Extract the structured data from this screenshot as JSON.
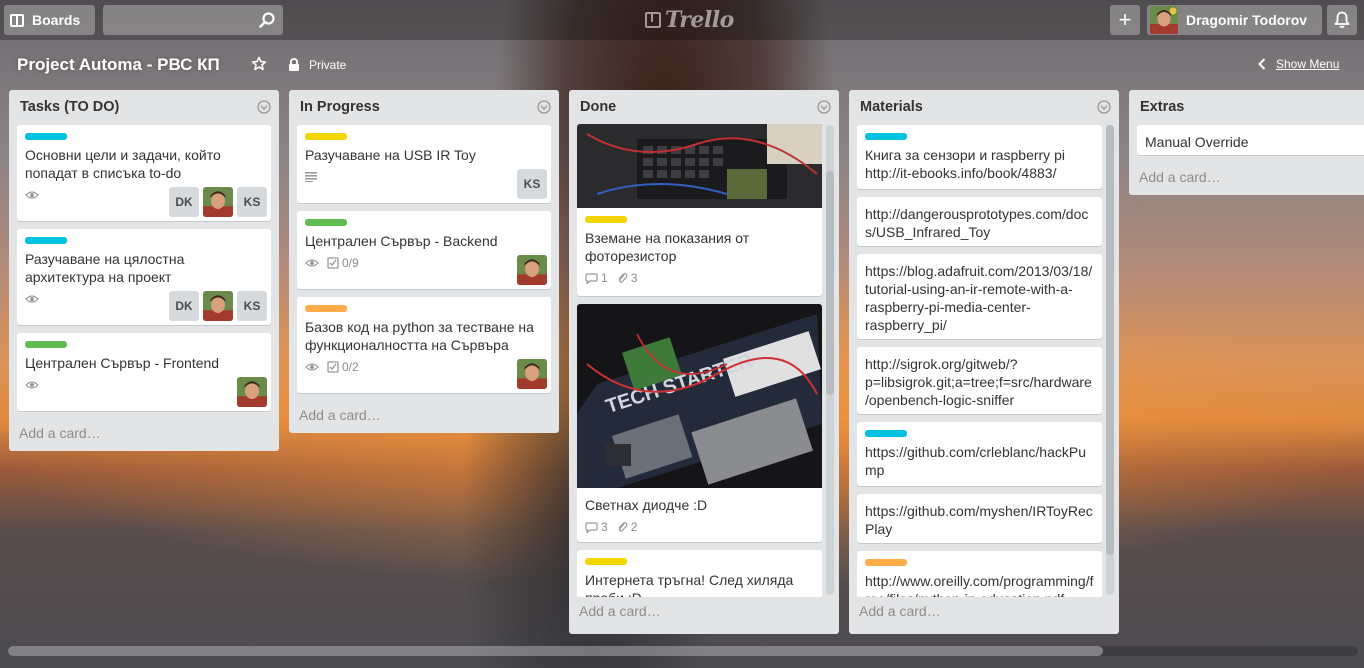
{
  "header": {
    "boards_label": "Boards",
    "search_placeholder": "",
    "logo_text": "Trello",
    "add_label": "+",
    "user_name": "Dragomir Todorov"
  },
  "board": {
    "title": "Project Automa - РВС КП",
    "visibility": "Private",
    "show_menu": "Show Menu"
  },
  "colors": {
    "blue": "#00c2e0",
    "yellow": "#f2d600",
    "green": "#61bd4f",
    "orange": "#ffab4a"
  },
  "lists": [
    {
      "title": "Tasks (TO DO)",
      "add_card": "Add a card…",
      "cards": [
        {
          "label": "blue",
          "title": "Основни цели и задачи, който попадат в списъка to-do",
          "members": [
            "DK",
            "avatar",
            "KS"
          ]
        },
        {
          "label": "blue",
          "title": "Разучаване на цялостна архитектура на проект",
          "members": [
            "DK",
            "avatar",
            "KS"
          ]
        },
        {
          "label": "green",
          "title": "Централен Сървър - Frontend",
          "members": [
            "avatar"
          ]
        }
      ]
    },
    {
      "title": "In Progress",
      "add_card": "Add a card…",
      "cards": [
        {
          "label": "yellow",
          "title": "Разучаване на USB IR Toy",
          "members": [
            "KS"
          ]
        },
        {
          "label": "green",
          "title": "Централен Сървър - Backend",
          "checklist": "0/9",
          "members": [
            "avatar"
          ]
        },
        {
          "label": "orange",
          "title": "Базов код на python за тестване на функционалността на Сървъра",
          "checklist": "0/2",
          "members": [
            "avatar"
          ]
        }
      ]
    },
    {
      "title": "Done",
      "add_card": "Add a card…",
      "cards": [
        {
          "label": "yellow",
          "title": "Вземане на показания от фоторезистор",
          "comments": "1",
          "attachments": "3"
        },
        {
          "title": "Светнах диодче :D",
          "comments": "3",
          "attachments": "2"
        },
        {
          "label": "yellow",
          "title": "Интернета тръгна! След хиляда проби :D"
        }
      ]
    },
    {
      "title": "Materials",
      "add_card": "Add a card…",
      "cards": [
        {
          "label": "blue",
          "title": "Книга за сензори и raspberry pi http://it-ebooks.info/book/4883/"
        },
        {
          "title": "http://dangerousprototypes.com/docs/USB_Infrared_Toy"
        },
        {
          "title": "https://blog.adafruit.com/2013/03/18/tutorial-using-an-ir-remote-with-a-raspberry-pi-media-center-raspberry_pi/"
        },
        {
          "title": "http://sigrok.org/gitweb/?p=libsigrok.git;a=tree;f=src/hardware/openbench-logic-sniffer"
        },
        {
          "label": "blue",
          "title": "https://github.com/crleblanc/hackPump"
        },
        {
          "title": "https://github.com/myshen/IRToyRecPlay"
        },
        {
          "label": "orange",
          "title": "http://www.oreilly.com/programming/free/files/python-in-education.pdf"
        }
      ]
    },
    {
      "title": "Extras",
      "add_card": "Add a card…",
      "cards": [
        {
          "title": "Manual Override"
        }
      ]
    }
  ]
}
